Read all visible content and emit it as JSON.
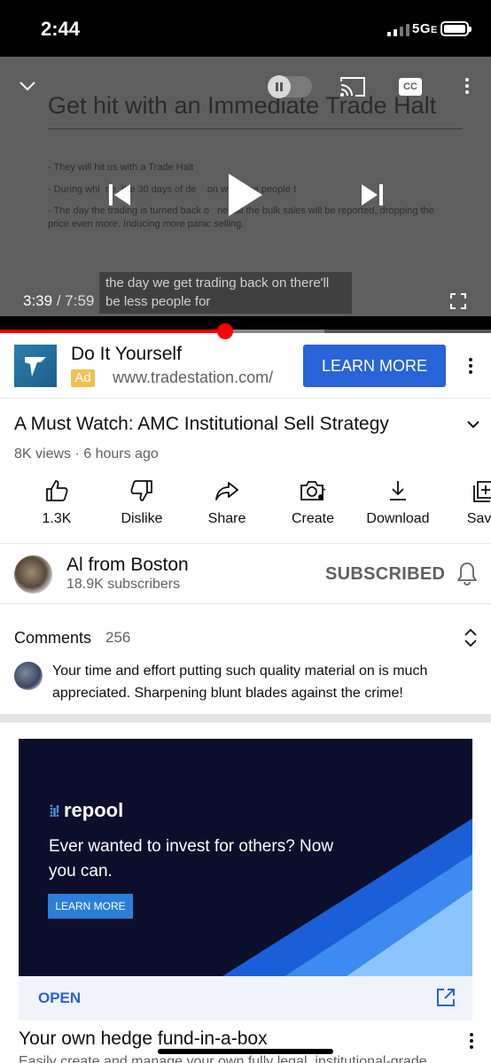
{
  "status_bar": {
    "time": "2:44",
    "network": "5G",
    "network_suffix": "E"
  },
  "video": {
    "slide_title": "Get hit with an Immediate Trade Halt",
    "slide_lines": [
      "- They will hit us with a Trade Halt",
      "- During whi  ne, the 30 days of de    on will force people t",
      "- The day the trading is turned back o   ne, all the bulk sales will be reported, dropping the price even more. Inducing more panic selling."
    ],
    "cc_label": "CC",
    "caption": "the day we get trading back on there'll be less people for",
    "current_time": "3:39",
    "separator": " / ",
    "duration": "7:59",
    "progress_played_fraction": 0.458,
    "progress_buffered_fraction": 0.66
  },
  "ad_row": {
    "title": "Do It Yourself",
    "badge": "Ad",
    "url": "www.tradestation.com/",
    "cta": "LEARN MORE"
  },
  "video_info": {
    "title": "A Must Watch: AMC Institutional Sell Strategy",
    "meta": "8K views · 6 hours ago"
  },
  "actions": [
    {
      "label": "1.3K",
      "icon": "thumb-up-icon"
    },
    {
      "label": "Dislike",
      "icon": "thumb-down-icon"
    },
    {
      "label": "Share",
      "icon": "share-icon"
    },
    {
      "label": "Create",
      "icon": "create-icon"
    },
    {
      "label": "Download",
      "icon": "download-icon"
    },
    {
      "label": "Save",
      "icon": "save-icon"
    }
  ],
  "channel": {
    "name": "Al from Boston",
    "subscribers": "18.9K subscribers",
    "subscribe_state": "SUBSCRIBED"
  },
  "comments": {
    "header": "Comments",
    "count": "256",
    "top_comment": "Your time and effort putting such quality material on is much appreciated. Sharpening blunt blades against the crime! Greetings..."
  },
  "display_ad": {
    "brand": "repool",
    "headline": "Ever wanted to invest for others? Now you can.",
    "cta": "LEARN MORE",
    "open_label": "OPEN",
    "title": "Your own hedge fund-in-a-box",
    "subtitle": "Easily create and manage your own fully legal, institutional-grade",
    "colors": {
      "background": "#0b0f2c",
      "accent": "#2a7fd9"
    }
  },
  "colors": {
    "progress": "#ff0000",
    "primary_button": "#2863d7",
    "ad_badge": "#f2c14e"
  }
}
